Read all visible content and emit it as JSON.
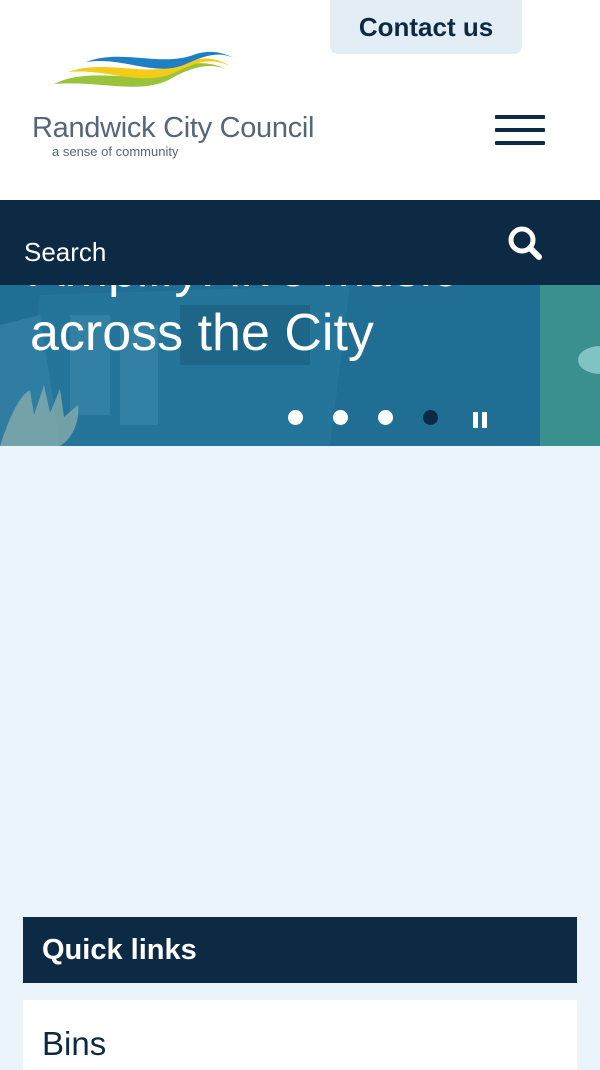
{
  "header": {
    "contact_label": "Contact us",
    "logo": {
      "name": "Randwick City Council",
      "tagline": "a sense of community",
      "colors": {
        "blue": "#1f7fc4",
        "yellow": "#f2cc17",
        "green": "#9ac33c"
      }
    },
    "menu_icon": "hamburger-menu-icon"
  },
  "search": {
    "placeholder": "Search",
    "icon": "search-icon"
  },
  "hero": {
    "title": "Amplify: live music across the City",
    "slide_count": 4,
    "active_slide": 4,
    "pause_icon": "pause-icon"
  },
  "quick_links": {
    "heading": "Quick links",
    "items": [
      {
        "label": "Bins"
      }
    ]
  },
  "colors": {
    "navy": "#0d2a45",
    "page_background": "#ebf3fb",
    "hero_teal": "#206e94",
    "contact_background": "#e3edf6"
  }
}
